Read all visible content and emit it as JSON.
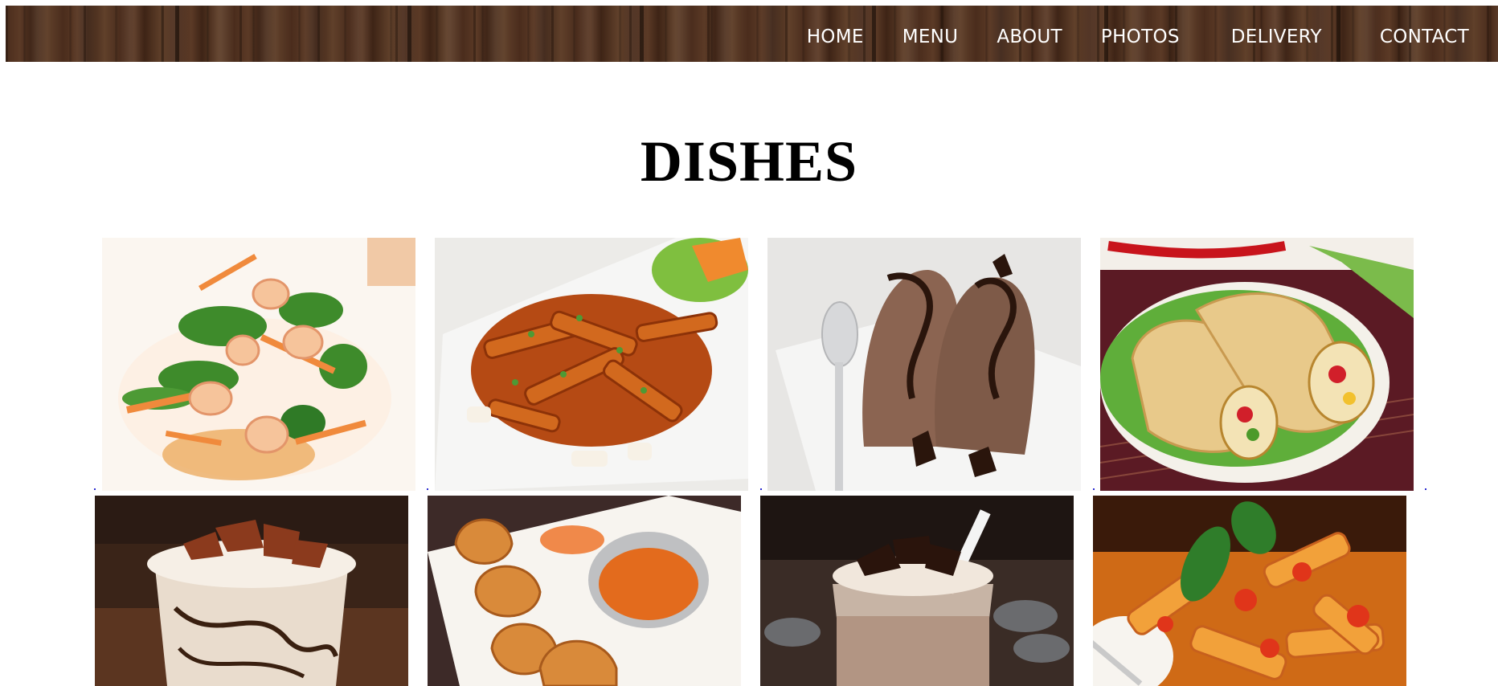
{
  "nav": {
    "items": [
      {
        "label": "HOME"
      },
      {
        "label": "MENU"
      },
      {
        "label": "ABOUT"
      },
      {
        "label": "PHOTOS"
      },
      {
        "label": "DELIVERY"
      },
      {
        "label": "CONTACT"
      }
    ]
  },
  "page": {
    "title": "DISHES"
  },
  "gallery": {
    "dishes": [
      {
        "icon": "shrimp-salad-image"
      },
      {
        "icon": "tteokbokki-image"
      },
      {
        "icon": "chocolate-ice-cream-image"
      },
      {
        "icon": "wraps-image"
      },
      {
        "icon": "iced-coffee-image"
      },
      {
        "icon": "fried-dumplings-image"
      },
      {
        "icon": "chocolate-milkshake-image"
      },
      {
        "icon": "penne-pasta-image"
      }
    ]
  }
}
